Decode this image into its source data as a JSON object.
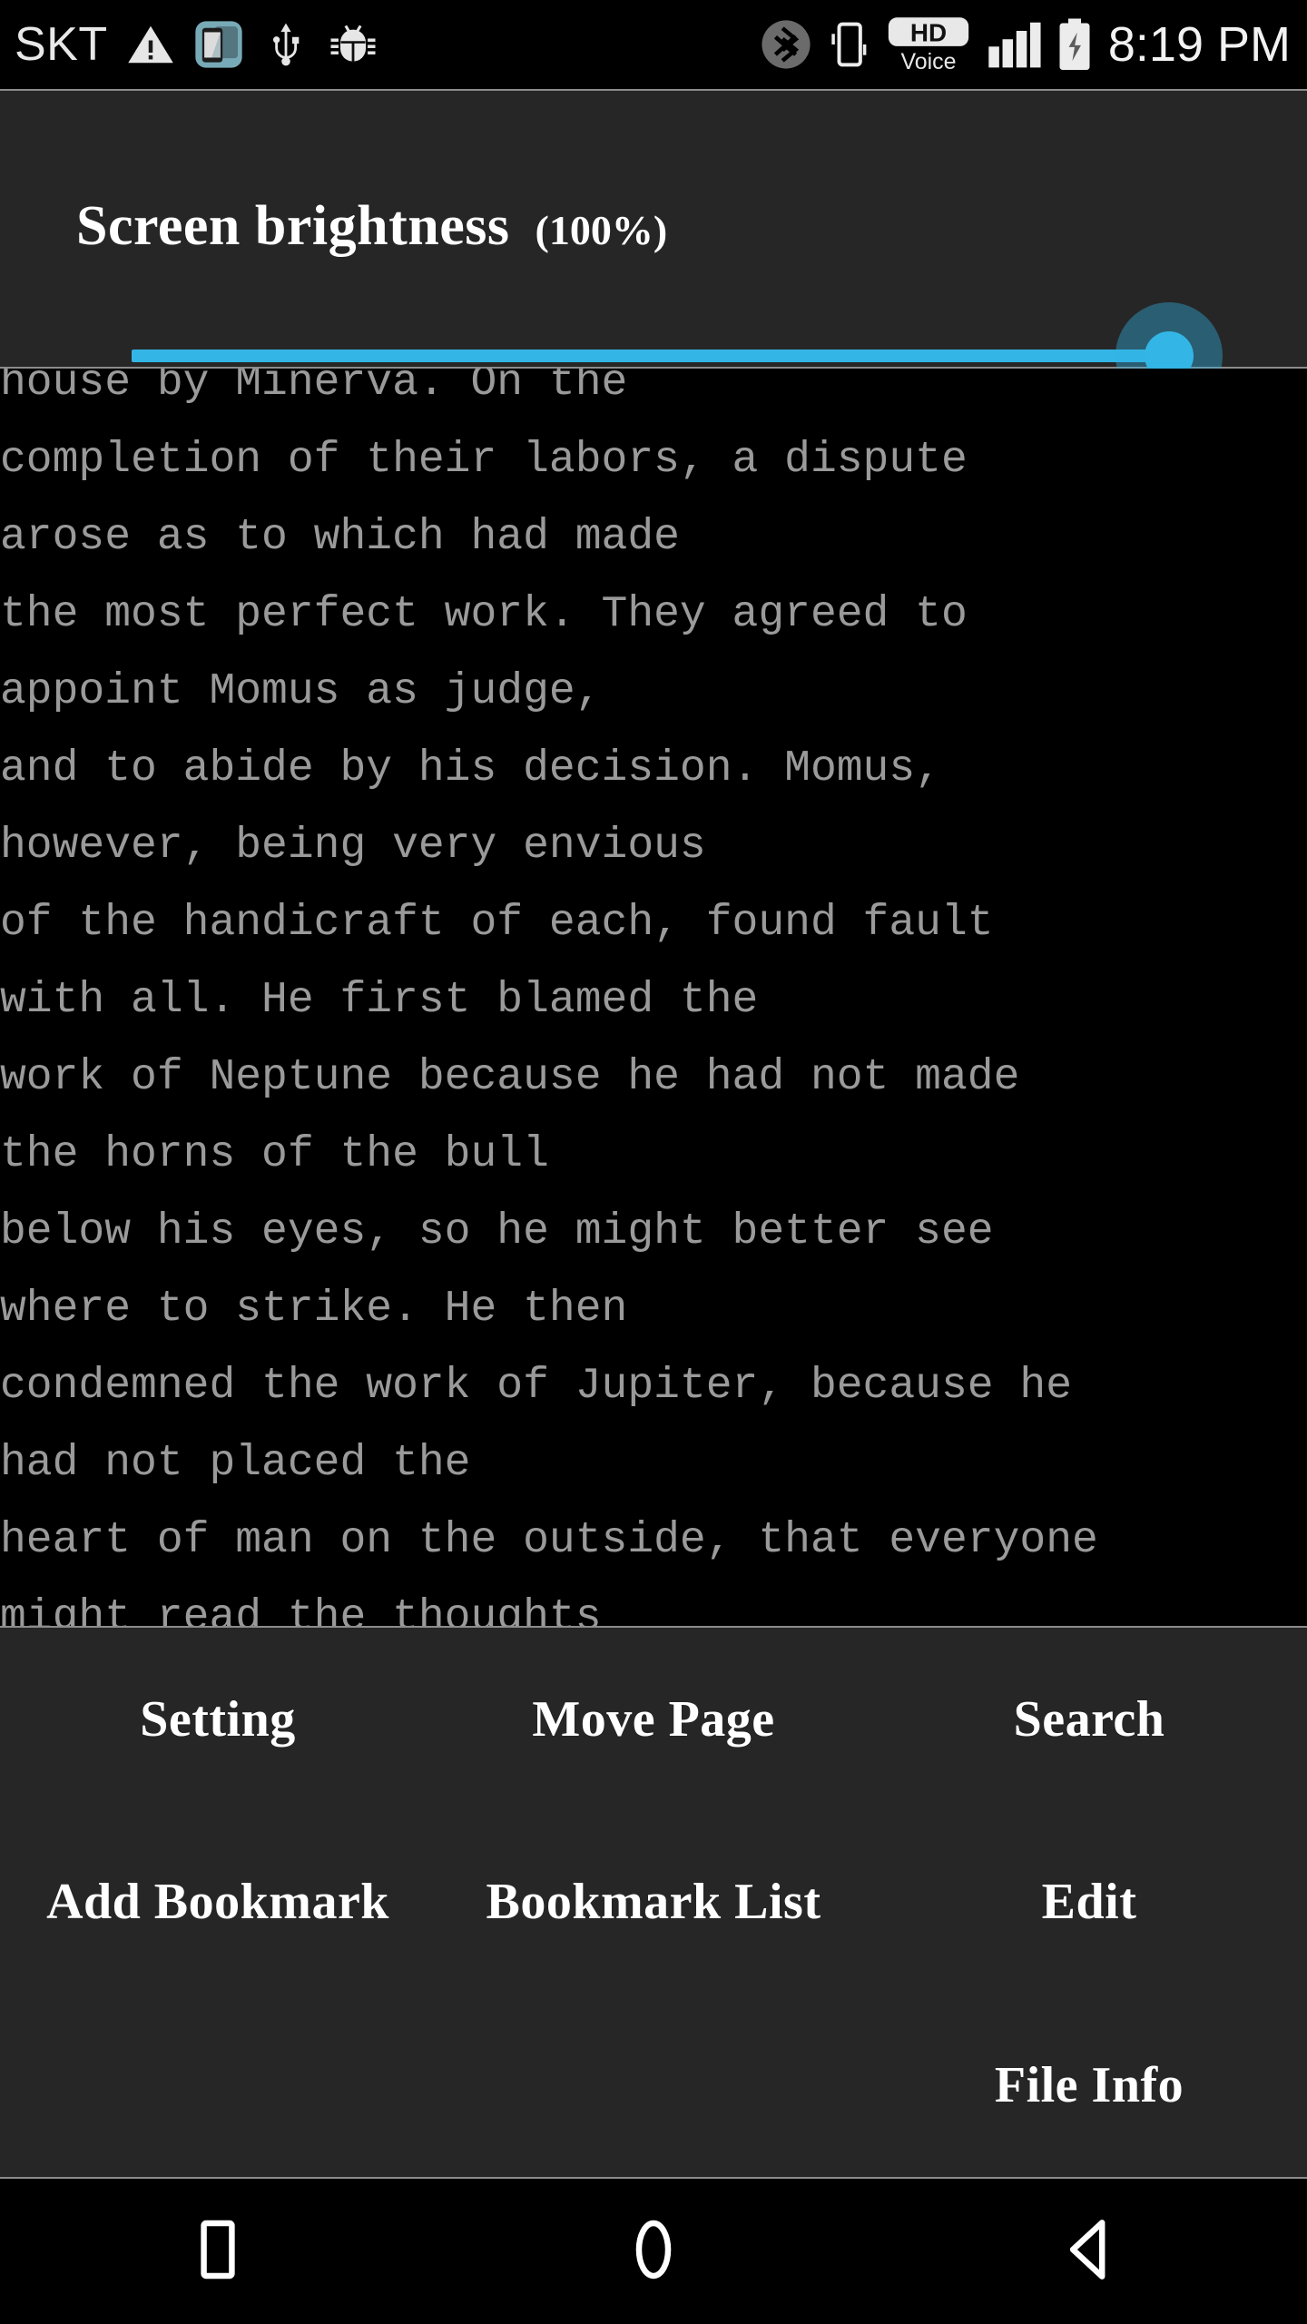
{
  "statusbar": {
    "carrier": "SKT",
    "time": "8:19 PM",
    "hd_label": "HD",
    "voice_label": "Voice",
    "icons_left": [
      "carrier-skt",
      "warning-triangle-icon",
      "app-phone-icon",
      "usb-icon",
      "debug-bug-icon"
    ],
    "icons_right": [
      "bluetooth-icon",
      "vibrate-icon",
      "hd-voice-icon",
      "signal-bars-icon",
      "battery-charging-icon"
    ]
  },
  "brightness": {
    "title": "Screen brightness",
    "percent_label": "(100%)",
    "value": 100,
    "accent_color": "#33b5e5",
    "panel_bg": "#262626"
  },
  "reader": {
    "text_color": "#9a9a9a",
    "lines": [
      "house by Minerva. On the",
      "completion of their labors, a dispute",
      "arose as to which had made",
      "the most perfect work. They agreed to",
      "appoint Momus as judge,",
      "and to abide by his decision. Momus,",
      "however, being very envious",
      "of the handicraft of each, found fault",
      "with all. He first blamed the",
      "work of Neptune because he had not made",
      "the horns of the bull",
      "below his eyes, so he might better see",
      "where to strike. He then",
      "condemned the work of Jupiter, because he",
      "had not placed the",
      "heart of man on the outside, that everyone",
      "might read the thoughts"
    ]
  },
  "menu": {
    "rows": [
      [
        "Setting",
        "Move Page",
        "Search"
      ],
      [
        "Add Bookmark",
        "Bookmark List",
        "Edit"
      ],
      [
        "",
        "",
        "File Info"
      ]
    ]
  },
  "navbar": {
    "buttons": [
      "recents-square-icon",
      "home-circle-icon",
      "back-triangle-icon"
    ]
  }
}
